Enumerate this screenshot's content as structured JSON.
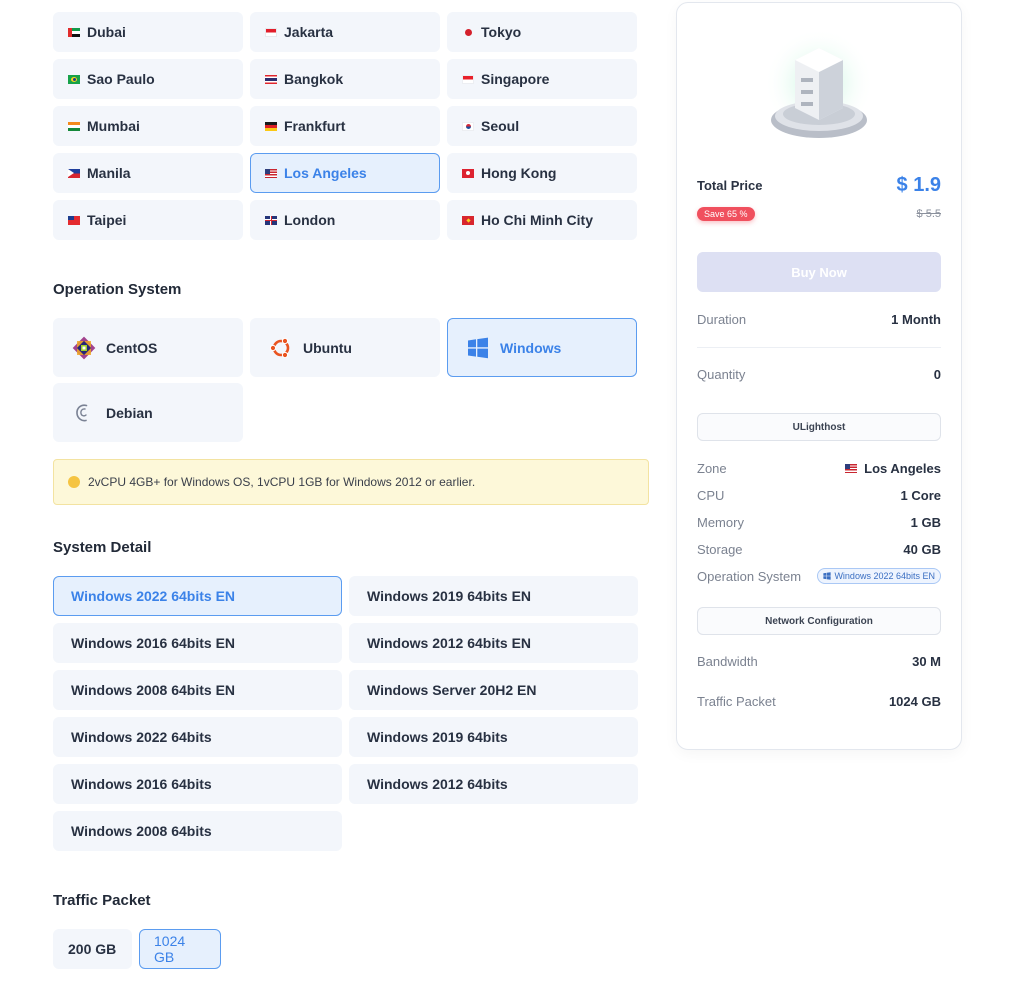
{
  "locations": [
    {
      "label": "Dubai",
      "flag": "ae",
      "selected": false
    },
    {
      "label": "Jakarta",
      "flag": "id",
      "selected": false
    },
    {
      "label": "Tokyo",
      "flag": "jp",
      "selected": false
    },
    {
      "label": "Sao Paulo",
      "flag": "br",
      "selected": false
    },
    {
      "label": "Bangkok",
      "flag": "th",
      "selected": false
    },
    {
      "label": "Singapore",
      "flag": "sg",
      "selected": false
    },
    {
      "label": "Mumbai",
      "flag": "in",
      "selected": false
    },
    {
      "label": "Frankfurt",
      "flag": "de",
      "selected": false
    },
    {
      "label": "Seoul",
      "flag": "kr",
      "selected": false
    },
    {
      "label": "Manila",
      "flag": "ph",
      "selected": false
    },
    {
      "label": "Los Angeles",
      "flag": "us",
      "selected": true
    },
    {
      "label": "Hong Kong",
      "flag": "hk",
      "selected": false
    },
    {
      "label": "Taipei",
      "flag": "tw",
      "selected": false
    },
    {
      "label": "London",
      "flag": "gb",
      "selected": false
    },
    {
      "label": "Ho Chi Minh City",
      "flag": "vn",
      "selected": false
    }
  ],
  "os_section": {
    "title": "Operation System",
    "options": [
      {
        "label": "CentOS",
        "icon": "centos-icon",
        "selected": false
      },
      {
        "label": "Ubuntu",
        "icon": "ubuntu-icon",
        "selected": false
      },
      {
        "label": "Windows",
        "icon": "windows-icon",
        "selected": true
      },
      {
        "label": "Debian",
        "icon": "debian-icon",
        "selected": false
      }
    ],
    "notice": "2vCPU 4GB+ for Windows OS, 1vCPU 1GB for Windows 2012 or earlier."
  },
  "system_detail": {
    "title": "System Detail",
    "options": [
      {
        "label": "Windows 2022 64bits EN",
        "selected": true
      },
      {
        "label": "Windows 2019 64bits EN",
        "selected": false
      },
      {
        "label": "Windows 2016 64bits EN",
        "selected": false
      },
      {
        "label": "Windows 2012 64bits EN",
        "selected": false
      },
      {
        "label": "Windows 2008 64bits EN",
        "selected": false
      },
      {
        "label": "Windows Server 20H2 EN",
        "selected": false
      },
      {
        "label": "Windows 2022 64bits",
        "selected": false
      },
      {
        "label": "Windows 2019 64bits",
        "selected": false
      },
      {
        "label": "Windows 2016 64bits",
        "selected": false
      },
      {
        "label": "Windows 2012 64bits",
        "selected": false
      },
      {
        "label": "Windows 2008 64bits",
        "selected": false
      }
    ]
  },
  "traffic_packet": {
    "title": "Traffic Packet",
    "options": [
      {
        "label": "200 GB",
        "selected": false
      },
      {
        "label": "1024 GB",
        "selected": true
      }
    ]
  },
  "summary": {
    "total_price_label": "Total Price",
    "price": "$ 1.9",
    "save_badge": "Save 65 %",
    "original_price": "$ 5.5",
    "buy_button": "Buy Now",
    "duration_label": "Duration",
    "duration_value": "1 Month",
    "quantity_label": "Quantity",
    "quantity_value": "0",
    "provider": "ULighthost",
    "zone_label": "Zone",
    "zone_value": "Los Angeles",
    "cpu_label": "CPU",
    "cpu_value": "1 Core",
    "memory_label": "Memory",
    "memory_value": "1 GB",
    "storage_label": "Storage",
    "storage_value": "40 GB",
    "os_label": "Operation System",
    "os_value": "Windows 2022 64bits EN",
    "network_config": "Network Configuration",
    "bandwidth_label": "Bandwidth",
    "bandwidth_value": "30 M",
    "traffic_label": "Traffic Packet",
    "traffic_value": "1024 GB"
  },
  "colors": {
    "accent": "#3b82e8",
    "tile_bg": "#f3f6fb",
    "selected_bg": "#e6f0fd",
    "notice_bg": "#fdf8d9",
    "save_badge": "#f0505e",
    "buy_disabled": "#dde0f3"
  }
}
